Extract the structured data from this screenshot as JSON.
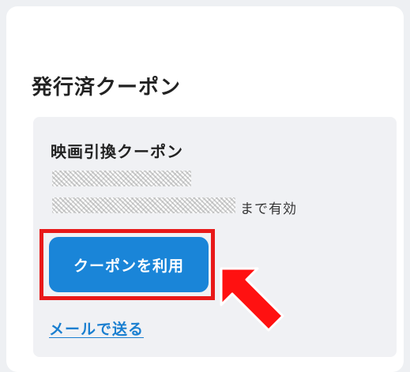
{
  "section": {
    "title": "発行済クーポン"
  },
  "coupon": {
    "title": "映画引換クーポン",
    "expiry_suffix": "まで有効",
    "use_button_label": "クーポンを利用",
    "send_link_label": "メールで送る"
  },
  "annotation": {
    "highlight_color": "#e81919",
    "arrow_icon": "red-arrow-icon"
  },
  "colors": {
    "button_blue": "#1a85d8",
    "link_blue": "#1a7fd0"
  }
}
